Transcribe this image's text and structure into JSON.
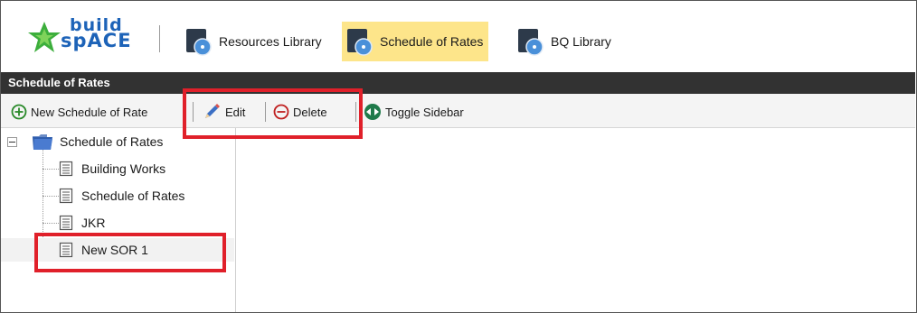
{
  "brand": {
    "line1": "build",
    "line2": "spACE"
  },
  "libraries": [
    {
      "label": "Resources Library",
      "active": false
    },
    {
      "label": "Schedule of Rates",
      "active": true
    },
    {
      "label": "BQ Library",
      "active": false
    }
  ],
  "panel_title": "Schedule of Rates",
  "toolbar": {
    "new_label": "New Schedule of Rate",
    "edit_label": "Edit",
    "delete_label": "Delete",
    "toggle_label": "Toggle Sidebar"
  },
  "tree": {
    "root_label": "Schedule of Rates",
    "items": [
      {
        "label": "Building Works"
      },
      {
        "label": "Schedule of Rates"
      },
      {
        "label": "JKR"
      },
      {
        "label": "New SOR 1"
      }
    ]
  },
  "colors": {
    "accent_active": "#fde58a",
    "titlebar": "#323232",
    "highlight": "#e0202a",
    "brand_blue": "#1d63b8",
    "brand_green": "#3cae3c"
  }
}
